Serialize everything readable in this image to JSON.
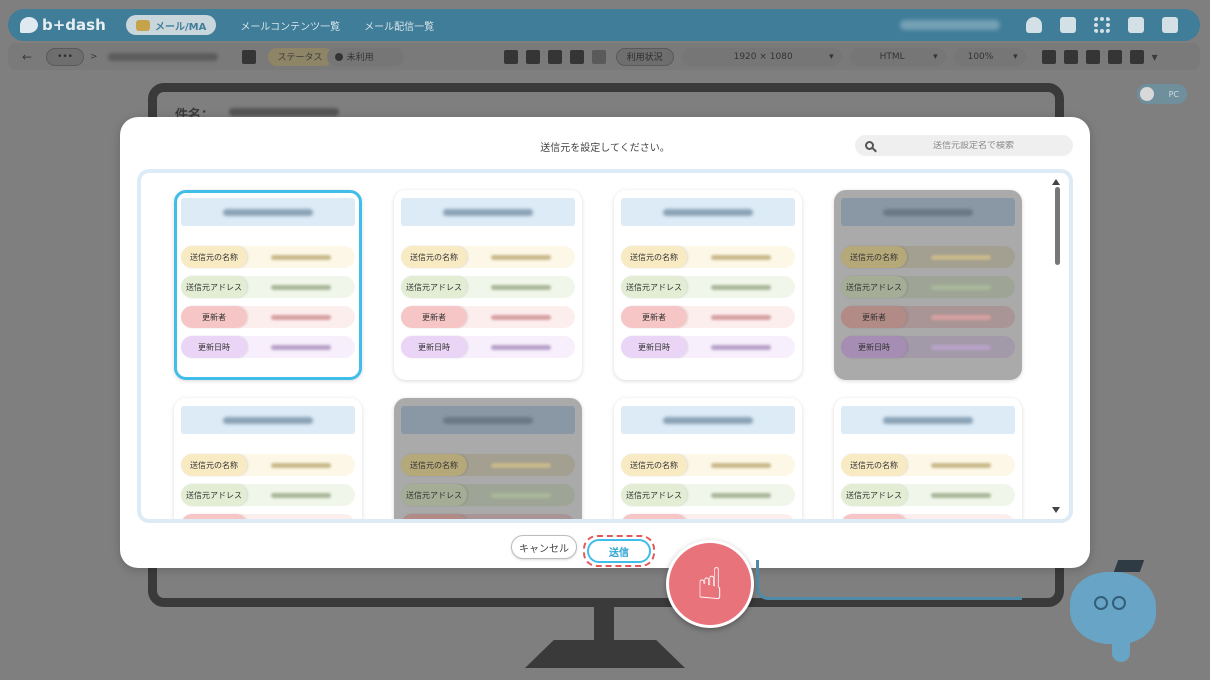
{
  "header": {
    "logo": "b+dash",
    "mode": "メール/MA",
    "nav": [
      "メールコンテンツ一覧",
      "メール配信一覧"
    ]
  },
  "toolbar": {
    "back": "←",
    "more": "•••",
    "sep": ">",
    "status_label": "ステータス",
    "status_value": "未利用",
    "usage_button": "利用状況",
    "resolution": "1920 × 1080",
    "format": "HTML",
    "zoom": "100%"
  },
  "monitor": {
    "subject_label": "件名："
  },
  "toggle": {
    "label": "PC"
  },
  "modal": {
    "title": "送信元を設定してください。",
    "search_placeholder": "送信元設定名で検索",
    "cancel_label": "キャンセル",
    "send_label": "送信"
  },
  "card_fields": {
    "name": "送信元の名称",
    "address": "送信元アドレス",
    "updater": "更新者",
    "updated_at": "更新日時"
  },
  "cards": [
    {
      "state": "selected"
    },
    {
      "state": "normal"
    },
    {
      "state": "normal"
    },
    {
      "state": "disabled"
    },
    {
      "state": "normal"
    },
    {
      "state": "disabled"
    },
    {
      "state": "normal"
    },
    {
      "state": "normal"
    }
  ],
  "colors": {
    "accent": "#41bde9",
    "header": "#3f7d98",
    "send_highlight": "#e25a5a"
  },
  "icons": [
    "bell-icon",
    "wrench-icon",
    "grid-icon",
    "chat-icon",
    "logout-icon",
    "search-icon",
    "pointer-hand-icon"
  ]
}
